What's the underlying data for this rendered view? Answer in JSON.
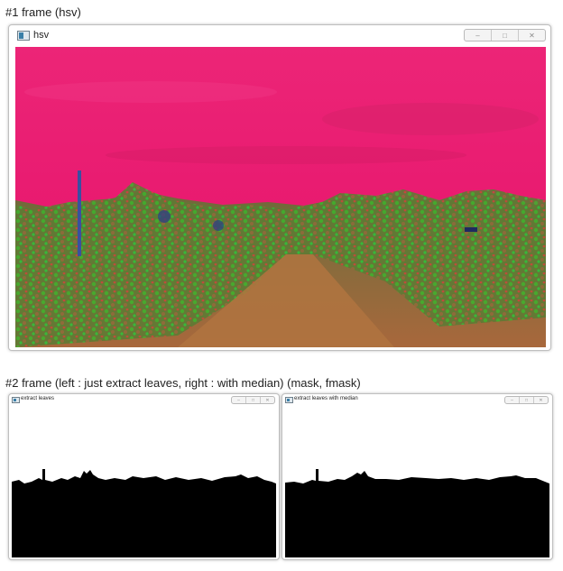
{
  "captions": {
    "frame1": "#1 frame (hsv)",
    "frame2": "#2 frame (left : just extract leaves, right : with median) (mask, fmask)"
  },
  "windows": {
    "hsv": {
      "title": "hsv"
    },
    "left": {
      "title": "extract leaves"
    },
    "right": {
      "title": "extract leaves with median"
    }
  },
  "window_controls": {
    "minimize": "–",
    "maximize": "□",
    "close": "✕"
  },
  "icons": {
    "app": "window-app-icon"
  },
  "colors": {
    "hsv_sky": "#e61a6e",
    "hsv_sky_light": "#f02a86",
    "hsv_ground": "#b06a3a",
    "vegetation_green": "#3fa82a",
    "mask_foreground": "#000000",
    "mask_background": "#ffffff"
  }
}
